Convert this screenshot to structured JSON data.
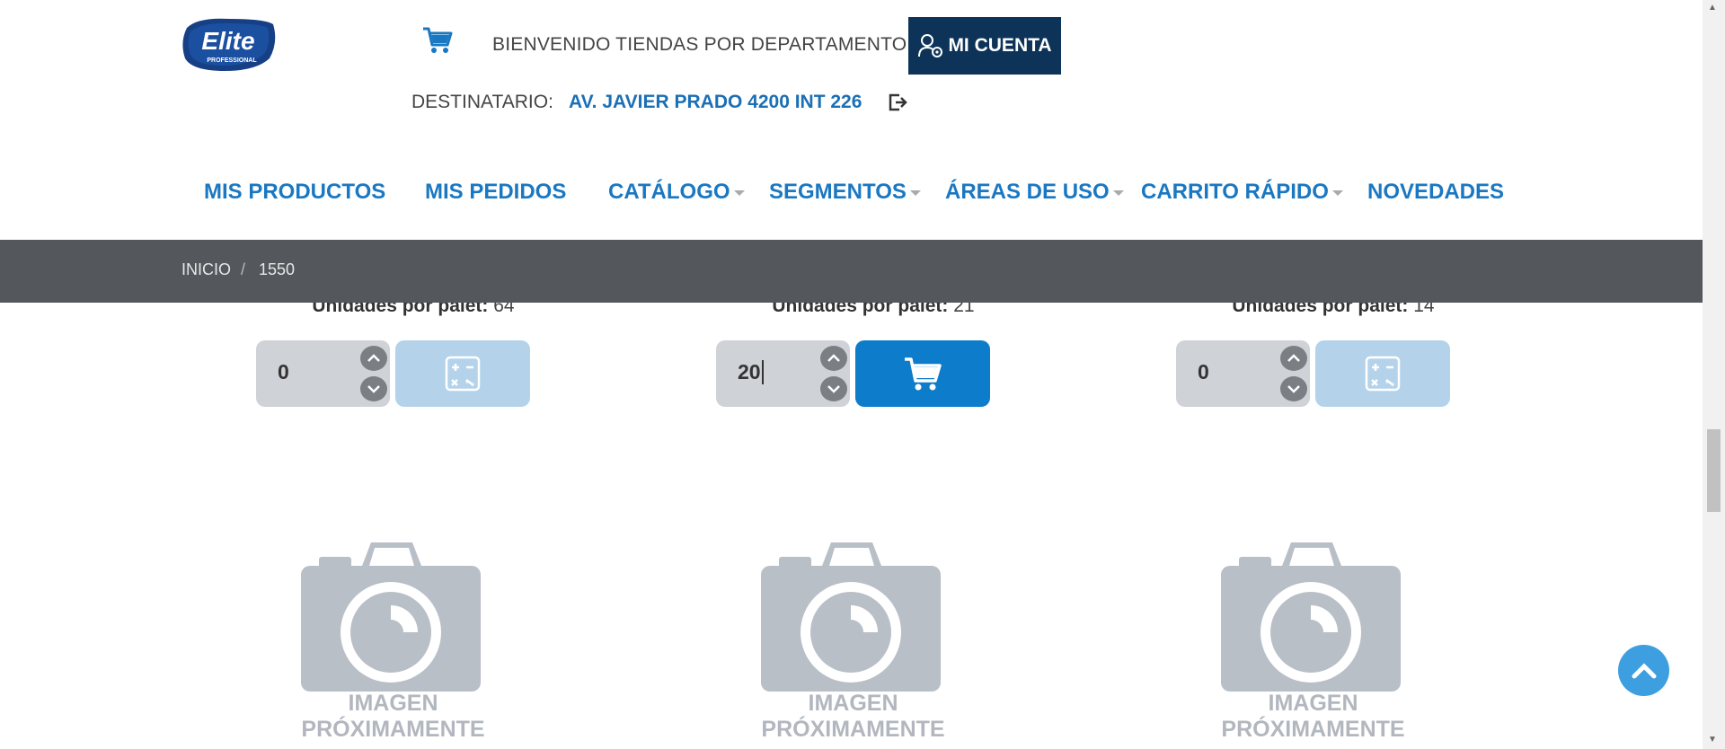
{
  "brand": {
    "logo_text": "Elite",
    "logo_subtext": "PROFESSIONAL"
  },
  "header": {
    "welcome": "BIENVENIDO TIENDAS POR DEPARTAMENTO",
    "account_label": "MI CUENTA",
    "recipient_label": "DESTINATARIO:",
    "recipient_value": "AV. JAVIER PRADO 4200 INT 226"
  },
  "nav": {
    "items": [
      {
        "label": "MIS PRODUCTOS"
      },
      {
        "label": "MIS PEDIDOS"
      },
      {
        "label": "CATÁLOGO"
      },
      {
        "label": "SEGMENTOS"
      },
      {
        "label": "ÁREAS DE USO"
      },
      {
        "label": "CARRITO RÁPIDO"
      },
      {
        "label": "NOVEDADES"
      }
    ]
  },
  "breadcrumb": {
    "home": "INICIO",
    "separator": "/",
    "current": "1550"
  },
  "products": [
    {
      "pallet_label": "Unidades por palet:",
      "pallet_units": "64",
      "quantity": "0",
      "action": "calculator-icon",
      "image_text_1": "IMAGEN",
      "image_text_2": "PRÓXIMAMENTE"
    },
    {
      "pallet_label": "Unidades por palet:",
      "pallet_units": "21",
      "quantity": "20",
      "action": "cart-icon",
      "image_text_1": "IMAGEN",
      "image_text_2": "PRÓXIMAMENTE"
    },
    {
      "pallet_label": "Unidades por palet:",
      "pallet_units": "14",
      "quantity": "0",
      "action": "calculator-icon",
      "image_text_1": "IMAGEN",
      "image_text_2": "PRÓXIMAMENTE"
    }
  ],
  "colors": {
    "nav_blue": "#1a78c2",
    "account_bg": "#0d3458",
    "breadcrumb_bg": "#54575c",
    "cart_button": "#0d7ccb",
    "calc_button_disabled": "#b4d3ea",
    "placeholder_gray": "#b2b7bf"
  }
}
